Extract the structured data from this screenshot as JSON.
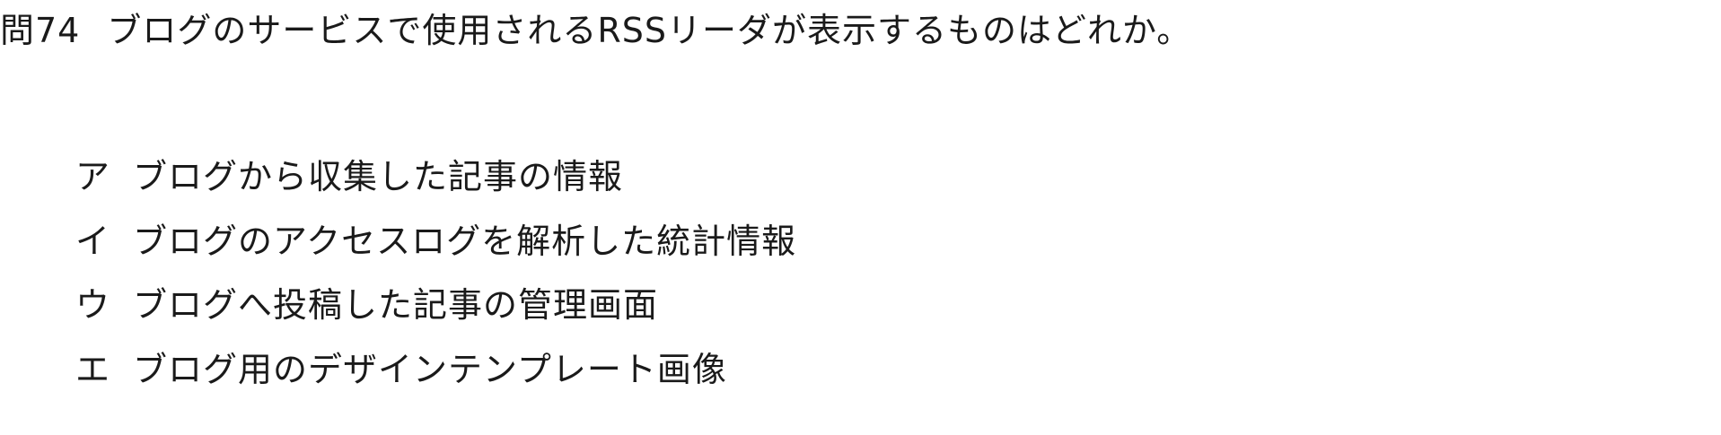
{
  "question": {
    "number": "問74",
    "text": "ブログのサービスで使用されるRSSリーダが表示するものはどれか。"
  },
  "choices": [
    {
      "label": "ア",
      "text": "ブログから収集した記事の情報"
    },
    {
      "label": "イ",
      "text": "ブログのアクセスログを解析した統計情報"
    },
    {
      "label": "ウ",
      "text": "ブログへ投稿した記事の管理画面"
    },
    {
      "label": "エ",
      "text": "ブログ用のデザインテンプレート画像"
    }
  ]
}
